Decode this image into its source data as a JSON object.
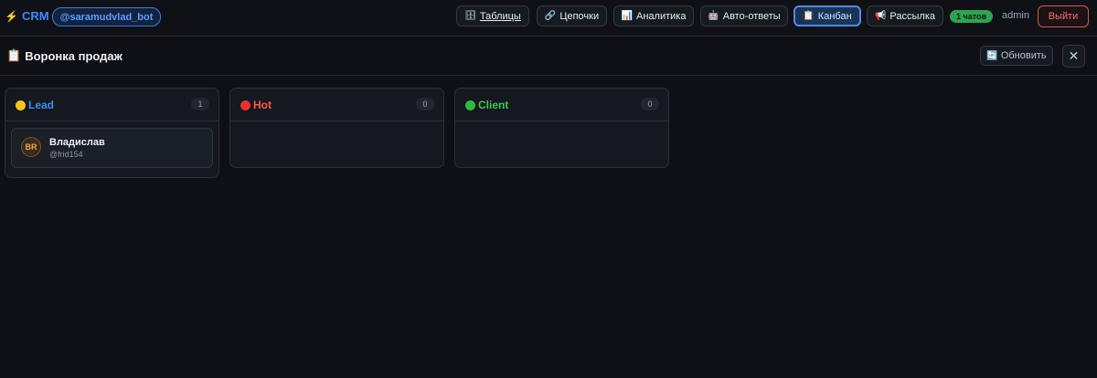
{
  "header": {
    "brand_icon": "⚡",
    "brand": "CRM",
    "bot": "@saramudvlad_bot",
    "nav": [
      {
        "icon": "🗄",
        "label": "Таблицы"
      },
      {
        "icon": "🔗",
        "label": "Цепочки"
      },
      {
        "icon": "📊",
        "label": "Аналитика"
      },
      {
        "icon": "🤖",
        "label": "Авто-ответы"
      },
      {
        "icon": "📋",
        "label": "Канбан"
      },
      {
        "icon": "📢",
        "label": "Рассылка"
      }
    ],
    "chats_badge": "1 чатов",
    "user": "admin",
    "logout": "Выйти"
  },
  "page": {
    "title_icon": "📋",
    "title": "Воронка продаж",
    "refresh_icon": "🔄",
    "refresh": "Обновить",
    "close_icon": "✕"
  },
  "kanban": {
    "columns": [
      {
        "title": "Lead",
        "count": "1",
        "color": "#f5c518",
        "title_color": "#3d8bff"
      },
      {
        "title": "Hot",
        "count": "0",
        "color": "#e5322d",
        "title_color": "#ff5a4f"
      },
      {
        "title": "Client",
        "count": "0",
        "color": "#2ebc3f",
        "title_color": "#3fc754"
      }
    ],
    "cards": [
      {
        "initials": "BR",
        "name": "Владислав",
        "handle": "@frid154"
      }
    ]
  }
}
